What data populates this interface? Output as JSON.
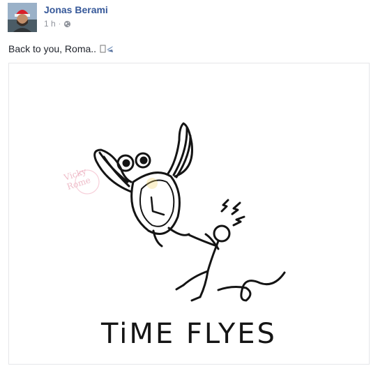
{
  "post": {
    "author": "Jonas Berami",
    "time": "1 h",
    "separator": "·",
    "privacy_icon": "globe-icon",
    "text": "Back to you, Roma..",
    "text_icon": "airplane-icon"
  },
  "image": {
    "caption": "TiME FLYES",
    "watermark": "Vicky Rome"
  }
}
